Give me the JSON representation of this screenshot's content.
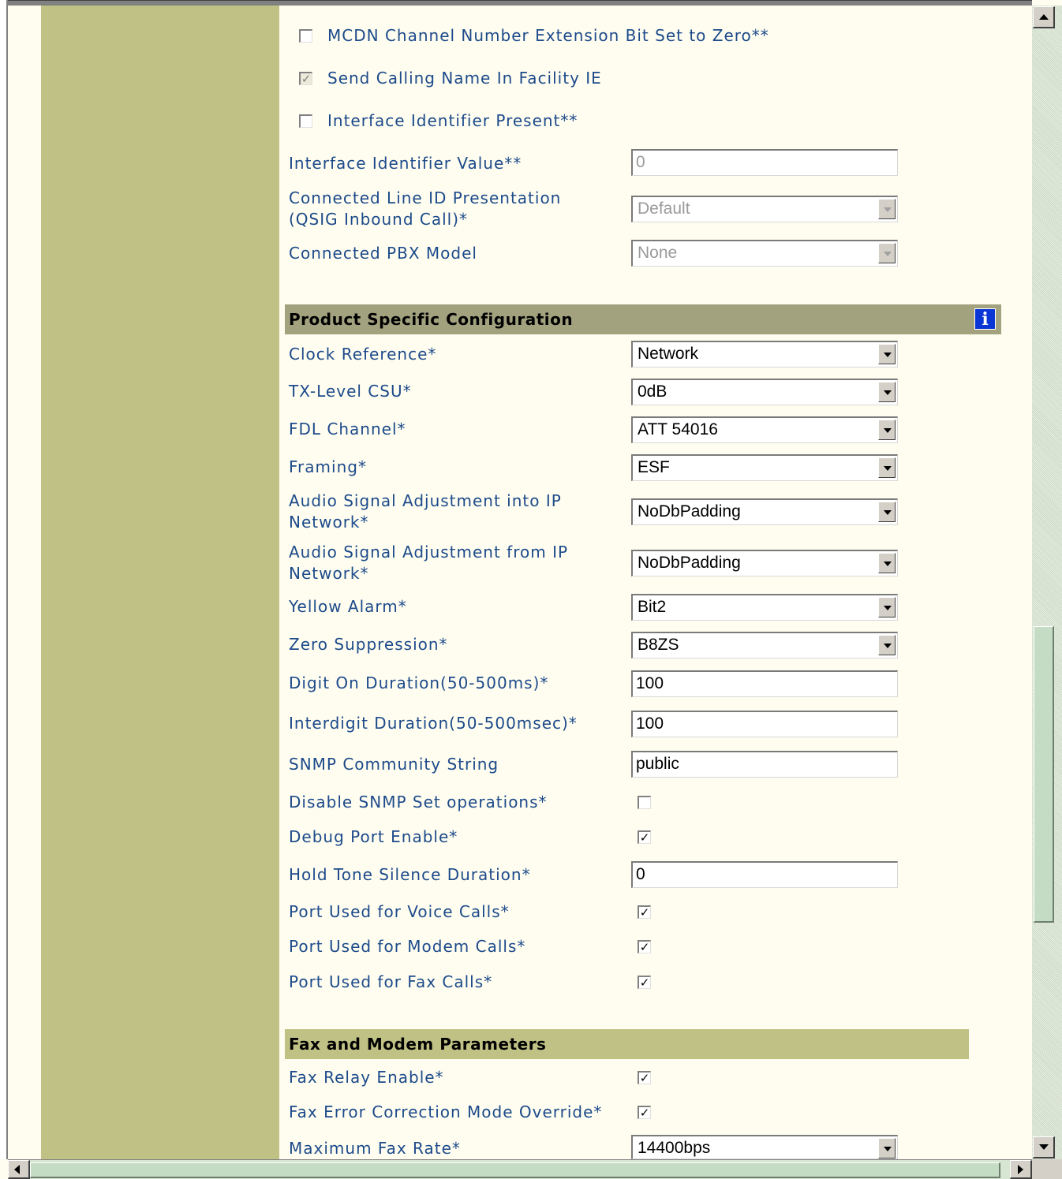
{
  "isdn_options": {
    "mcdn_label": "MCDN Channel Number Extension Bit Set to Zero**",
    "mcdn_checked": false,
    "send_calling_name_label": "Send Calling Name In Facility IE",
    "send_calling_name_checked": true,
    "iface_id_present_label": "Interface Identifier Present**",
    "iface_id_present_checked": false,
    "iface_id_value_label": "Interface Identifier Value**",
    "iface_id_value": "0",
    "connected_line_label_1": "Connected Line ID Presentation",
    "connected_line_label_2": "(QSIG Inbound Call)*",
    "connected_line_value": "Default",
    "pbx_model_label": "Connected PBX Model",
    "pbx_model_value": "None"
  },
  "product_config": {
    "header": "Product Specific Configuration",
    "info_glyph": "i",
    "clock_ref_label": "Clock Reference*",
    "clock_ref_value": "Network",
    "tx_level_label": "TX-Level CSU*",
    "tx_level_value": "0dB",
    "fdl_label": "FDL Channel*",
    "fdl_value": "ATT 54016",
    "framing_label": "Framing*",
    "framing_value": "ESF",
    "audio_into_label_1": "Audio Signal Adjustment into IP",
    "audio_into_label_2": "Network*",
    "audio_into_value": "NoDbPadding",
    "audio_from_label_1": "Audio Signal Adjustment from IP",
    "audio_from_label_2": "Network*",
    "audio_from_value": "NoDbPadding",
    "yellow_alarm_label": "Yellow Alarm*",
    "yellow_alarm_value": "Bit2",
    "zero_supp_label": "Zero Suppression*",
    "zero_supp_value": "B8ZS",
    "digit_on_label": "Digit On Duration(50-500ms)*",
    "digit_on_value": "100",
    "interdigit_label": "Interdigit Duration(50-500msec)*",
    "interdigit_value": "100",
    "snmp_label": "SNMP Community String",
    "snmp_value": "public",
    "disable_snmp_label": "Disable SNMP Set operations*",
    "disable_snmp_checked": false,
    "debug_port_label": "Debug Port Enable*",
    "debug_port_checked": true,
    "hold_tone_label": "Hold Tone Silence Duration*",
    "hold_tone_value": "0",
    "voice_calls_label": "Port Used for Voice Calls*",
    "voice_calls_checked": true,
    "modem_calls_label": "Port Used for Modem Calls*",
    "modem_calls_checked": true,
    "fax_calls_label": "Port Used for Fax Calls*",
    "fax_calls_checked": true
  },
  "fax_modem": {
    "header": "Fax and Modem Parameters",
    "fax_relay_label": "Fax Relay Enable*",
    "fax_relay_checked": true,
    "fax_ecm_label": "Fax Error Correction Mode Override*",
    "fax_ecm_checked": true,
    "max_fax_rate_label": "Maximum Fax Rate*",
    "max_fax_rate_value": "14400bps"
  },
  "colors": {
    "sidebar": "#c0c285",
    "content_bg": "#fefdf0",
    "label_text": "#1d4a8a",
    "product_header_bg": "#a3a27f",
    "fax_header_bg": "#c0c285",
    "info_icon": "#0b36d6"
  },
  "check_glyph": "✓"
}
